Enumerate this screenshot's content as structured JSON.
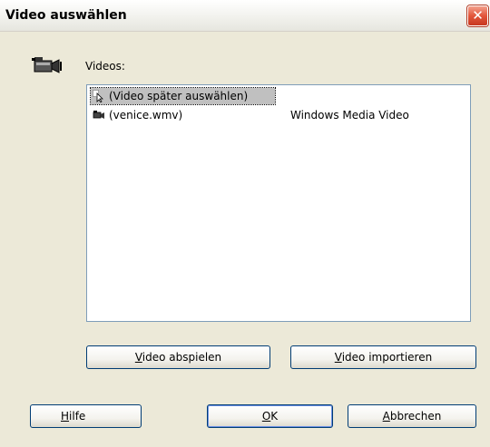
{
  "window": {
    "title": "Video auswählen",
    "close_icon": "close-icon"
  },
  "main": {
    "icon": "video-camera-icon",
    "videos_label": "Videos:",
    "list": {
      "items": [
        {
          "icon": "cursor-select-icon",
          "name": "(Video später auswählen)",
          "type": "",
          "selected": true
        },
        {
          "icon": "video-camera-small-icon",
          "name": "(venice.wmv)",
          "type": "Windows Media Video",
          "selected": false
        }
      ]
    },
    "buttons": {
      "play": {
        "accel": "V",
        "rest": "ideo abspielen"
      },
      "import": {
        "accel": "V",
        "rest": "ideo importieren"
      }
    }
  },
  "footer": {
    "help": {
      "accel": "H",
      "rest": "ilfe"
    },
    "ok": {
      "accel": "O",
      "rest": "K"
    },
    "cancel": {
      "accel": "A",
      "rest": "bbrechen"
    }
  },
  "colors": {
    "background": "#ece9d8",
    "selection": "#c0c0c0",
    "close_button": "#e2563b"
  }
}
